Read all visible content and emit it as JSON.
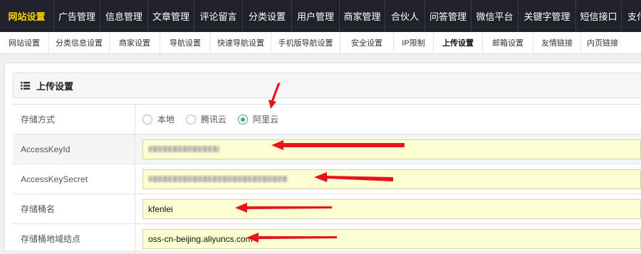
{
  "topnav": {
    "items": [
      {
        "label": "网站设置",
        "active": true
      },
      {
        "label": "广告管理",
        "active": false
      },
      {
        "label": "信息管理",
        "active": false
      },
      {
        "label": "文章管理",
        "active": false
      },
      {
        "label": "评论留言",
        "active": false
      },
      {
        "label": "分类设置",
        "active": false
      },
      {
        "label": "用户管理",
        "active": false
      },
      {
        "label": "商家管理",
        "active": false
      },
      {
        "label": "合伙人",
        "active": false
      },
      {
        "label": "问答管理",
        "active": false
      },
      {
        "label": "微信平台",
        "active": false
      },
      {
        "label": "关键字管理",
        "active": false
      },
      {
        "label": "短信接口",
        "active": false
      },
      {
        "label": "支付管理",
        "active": false
      }
    ]
  },
  "subnav": {
    "items": [
      {
        "label": "网站设置",
        "active": false
      },
      {
        "label": "分类信息设置",
        "active": false
      },
      {
        "label": "商家设置",
        "active": false
      },
      {
        "label": "导航设置",
        "active": false
      },
      {
        "label": "快速导航设置",
        "active": false
      },
      {
        "label": "手机版导航设置",
        "active": false
      },
      {
        "label": "安全设置",
        "active": false
      },
      {
        "label": "IP限制",
        "active": false
      },
      {
        "label": "上传设置",
        "active": true
      },
      {
        "label": "邮箱设置",
        "active": false
      },
      {
        "label": "友情链接",
        "active": false
      },
      {
        "label": "内页链接",
        "active": false
      }
    ]
  },
  "panel": {
    "title": "上传设置",
    "icon": "list-icon"
  },
  "form": {
    "storage": {
      "label": "存储方式",
      "options": [
        "本地",
        "腾讯云",
        "阿里云"
      ],
      "selected": "阿里云"
    },
    "access_key_id": {
      "label": "AccessKeyId",
      "value_masked": true
    },
    "access_key_secret": {
      "label": "AccessKeySecret",
      "value_masked": true
    },
    "bucket_name": {
      "label": "存储桶名",
      "value": "kfenlei"
    },
    "bucket_endpoint": {
      "label": "存储桶地域结点",
      "value": "oss-cn-beijing.aliyuncs.com"
    }
  },
  "colors": {
    "topnav_bg": "#1f2329",
    "active_top": "#ffd200",
    "input_bg": "#fdffd2",
    "radio_checked": "#3cae75",
    "annotation_arrow": "#e8141b"
  }
}
